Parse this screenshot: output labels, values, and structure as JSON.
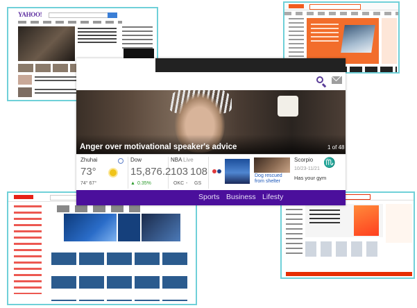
{
  "yahoo_thumb": {
    "logo": "YAHOO!"
  },
  "widget": {
    "headline": "Anger over motivational speaker's advice",
    "counter": "1 of 48",
    "weather": {
      "city": "Zhuhai",
      "temp": "73°",
      "range": "74° 67°"
    },
    "stock": {
      "name": "Dow",
      "value": "15,876.2",
      "change": "0.35%"
    },
    "nba": {
      "title": "NBA",
      "status": "Live",
      "score_home": "103",
      "score_away": "108",
      "team_home": "OKC",
      "separator": "-",
      "team_away": "GS"
    },
    "story": {
      "caption": "Dog rescued from shelter"
    },
    "horoscope": {
      "sign": "Scorpio",
      "dates": "10/23-11/21",
      "text": "Has your gym"
    },
    "nav": [
      "Sports",
      "Business",
      "Lifesty"
    ],
    "icons": [
      "search-icon",
      "mail-icon"
    ]
  },
  "colors": {
    "accent": "#4b0f9c",
    "thumb_border": "#6fd0d8",
    "stock_up": "#2b9a2b"
  }
}
